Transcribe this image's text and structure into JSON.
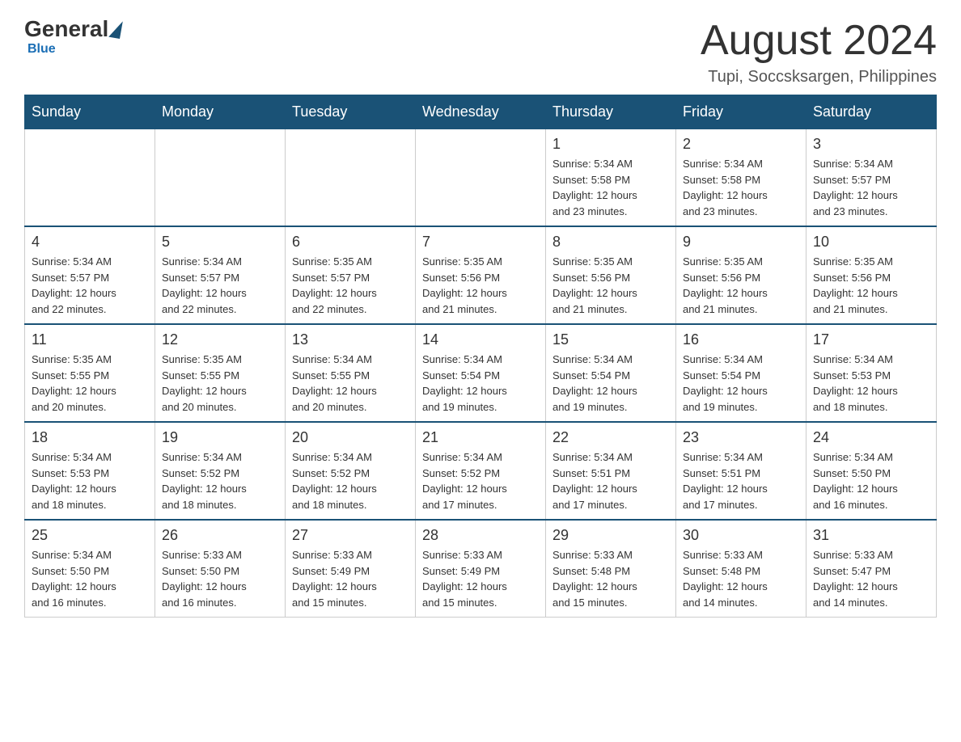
{
  "header": {
    "logo_general": "General",
    "logo_blue": "Blue",
    "month_title": "August 2024",
    "location": "Tupi, Soccsksargen, Philippines"
  },
  "weekdays": [
    "Sunday",
    "Monday",
    "Tuesday",
    "Wednesday",
    "Thursday",
    "Friday",
    "Saturday"
  ],
  "weeks": [
    [
      {
        "day": "",
        "info": ""
      },
      {
        "day": "",
        "info": ""
      },
      {
        "day": "",
        "info": ""
      },
      {
        "day": "",
        "info": ""
      },
      {
        "day": "1",
        "info": "Sunrise: 5:34 AM\nSunset: 5:58 PM\nDaylight: 12 hours\nand 23 minutes."
      },
      {
        "day": "2",
        "info": "Sunrise: 5:34 AM\nSunset: 5:58 PM\nDaylight: 12 hours\nand 23 minutes."
      },
      {
        "day": "3",
        "info": "Sunrise: 5:34 AM\nSunset: 5:57 PM\nDaylight: 12 hours\nand 23 minutes."
      }
    ],
    [
      {
        "day": "4",
        "info": "Sunrise: 5:34 AM\nSunset: 5:57 PM\nDaylight: 12 hours\nand 22 minutes."
      },
      {
        "day": "5",
        "info": "Sunrise: 5:34 AM\nSunset: 5:57 PM\nDaylight: 12 hours\nand 22 minutes."
      },
      {
        "day": "6",
        "info": "Sunrise: 5:35 AM\nSunset: 5:57 PM\nDaylight: 12 hours\nand 22 minutes."
      },
      {
        "day": "7",
        "info": "Sunrise: 5:35 AM\nSunset: 5:56 PM\nDaylight: 12 hours\nand 21 minutes."
      },
      {
        "day": "8",
        "info": "Sunrise: 5:35 AM\nSunset: 5:56 PM\nDaylight: 12 hours\nand 21 minutes."
      },
      {
        "day": "9",
        "info": "Sunrise: 5:35 AM\nSunset: 5:56 PM\nDaylight: 12 hours\nand 21 minutes."
      },
      {
        "day": "10",
        "info": "Sunrise: 5:35 AM\nSunset: 5:56 PM\nDaylight: 12 hours\nand 21 minutes."
      }
    ],
    [
      {
        "day": "11",
        "info": "Sunrise: 5:35 AM\nSunset: 5:55 PM\nDaylight: 12 hours\nand 20 minutes."
      },
      {
        "day": "12",
        "info": "Sunrise: 5:35 AM\nSunset: 5:55 PM\nDaylight: 12 hours\nand 20 minutes."
      },
      {
        "day": "13",
        "info": "Sunrise: 5:34 AM\nSunset: 5:55 PM\nDaylight: 12 hours\nand 20 minutes."
      },
      {
        "day": "14",
        "info": "Sunrise: 5:34 AM\nSunset: 5:54 PM\nDaylight: 12 hours\nand 19 minutes."
      },
      {
        "day": "15",
        "info": "Sunrise: 5:34 AM\nSunset: 5:54 PM\nDaylight: 12 hours\nand 19 minutes."
      },
      {
        "day": "16",
        "info": "Sunrise: 5:34 AM\nSunset: 5:54 PM\nDaylight: 12 hours\nand 19 minutes."
      },
      {
        "day": "17",
        "info": "Sunrise: 5:34 AM\nSunset: 5:53 PM\nDaylight: 12 hours\nand 18 minutes."
      }
    ],
    [
      {
        "day": "18",
        "info": "Sunrise: 5:34 AM\nSunset: 5:53 PM\nDaylight: 12 hours\nand 18 minutes."
      },
      {
        "day": "19",
        "info": "Sunrise: 5:34 AM\nSunset: 5:52 PM\nDaylight: 12 hours\nand 18 minutes."
      },
      {
        "day": "20",
        "info": "Sunrise: 5:34 AM\nSunset: 5:52 PM\nDaylight: 12 hours\nand 18 minutes."
      },
      {
        "day": "21",
        "info": "Sunrise: 5:34 AM\nSunset: 5:52 PM\nDaylight: 12 hours\nand 17 minutes."
      },
      {
        "day": "22",
        "info": "Sunrise: 5:34 AM\nSunset: 5:51 PM\nDaylight: 12 hours\nand 17 minutes."
      },
      {
        "day": "23",
        "info": "Sunrise: 5:34 AM\nSunset: 5:51 PM\nDaylight: 12 hours\nand 17 minutes."
      },
      {
        "day": "24",
        "info": "Sunrise: 5:34 AM\nSunset: 5:50 PM\nDaylight: 12 hours\nand 16 minutes."
      }
    ],
    [
      {
        "day": "25",
        "info": "Sunrise: 5:34 AM\nSunset: 5:50 PM\nDaylight: 12 hours\nand 16 minutes."
      },
      {
        "day": "26",
        "info": "Sunrise: 5:33 AM\nSunset: 5:50 PM\nDaylight: 12 hours\nand 16 minutes."
      },
      {
        "day": "27",
        "info": "Sunrise: 5:33 AM\nSunset: 5:49 PM\nDaylight: 12 hours\nand 15 minutes."
      },
      {
        "day": "28",
        "info": "Sunrise: 5:33 AM\nSunset: 5:49 PM\nDaylight: 12 hours\nand 15 minutes."
      },
      {
        "day": "29",
        "info": "Sunrise: 5:33 AM\nSunset: 5:48 PM\nDaylight: 12 hours\nand 15 minutes."
      },
      {
        "day": "30",
        "info": "Sunrise: 5:33 AM\nSunset: 5:48 PM\nDaylight: 12 hours\nand 14 minutes."
      },
      {
        "day": "31",
        "info": "Sunrise: 5:33 AM\nSunset: 5:47 PM\nDaylight: 12 hours\nand 14 minutes."
      }
    ]
  ]
}
